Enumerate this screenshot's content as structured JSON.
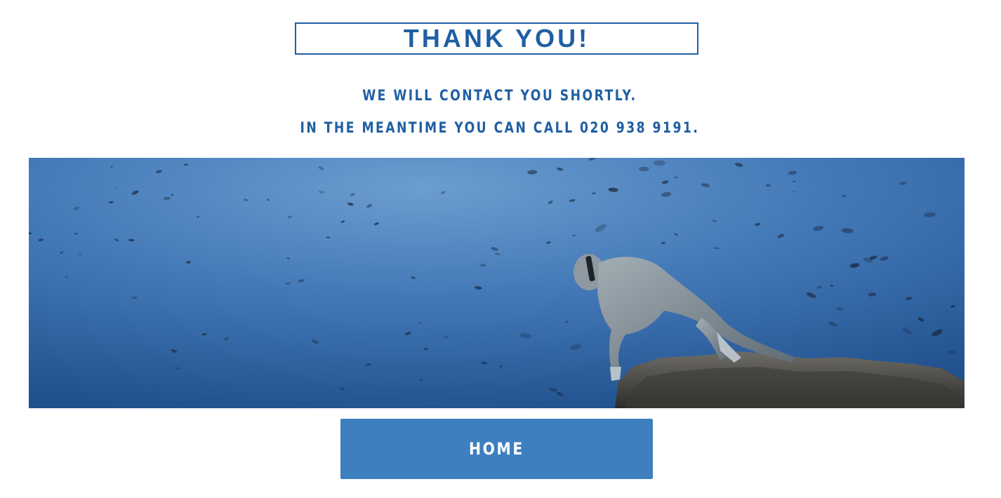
{
  "heading": {
    "title": "THANK YOU!"
  },
  "message": {
    "line1": "WE WILL CONTACT YOU SHORTLY.",
    "line2": "IN THE MEANTIME YOU CAN CALL 020 938 9191."
  },
  "hero": {
    "description_icon": "freediver-underwater-image"
  },
  "actions": {
    "home_label": "HOME"
  },
  "colors": {
    "accent": "#1f5fa3",
    "button": "#3d7fbf",
    "ocean_light": "#6a9bcf",
    "ocean_dark": "#1d4f8e"
  }
}
